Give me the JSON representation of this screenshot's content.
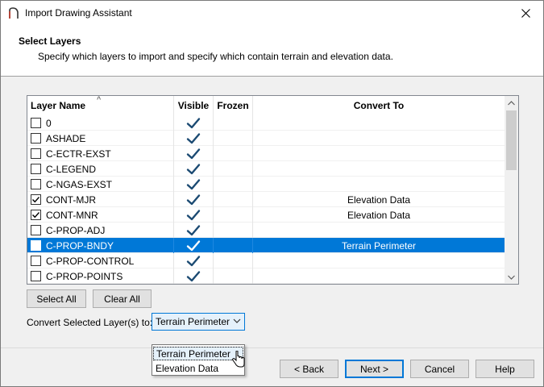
{
  "window": {
    "title": "Import Drawing Assistant",
    "close_glyph": "✕"
  },
  "header": {
    "title": "Select Layers",
    "subtitle": "Specify which layers to import and specify which contain terrain and elevation data."
  },
  "grid": {
    "columns": [
      "Layer Name",
      "Visible",
      "Frozen",
      "Convert To"
    ],
    "sort_glyph": "^",
    "rows": [
      {
        "name": "0",
        "checked": false,
        "visible": true,
        "frozen": false,
        "convert": "",
        "selected": false
      },
      {
        "name": "ASHADE",
        "checked": false,
        "visible": true,
        "frozen": false,
        "convert": "",
        "selected": false
      },
      {
        "name": "C-ECTR-EXST",
        "checked": false,
        "visible": true,
        "frozen": false,
        "convert": "",
        "selected": false
      },
      {
        "name": "C-LEGEND",
        "checked": false,
        "visible": true,
        "frozen": false,
        "convert": "",
        "selected": false
      },
      {
        "name": "C-NGAS-EXST",
        "checked": false,
        "visible": true,
        "frozen": false,
        "convert": "",
        "selected": false
      },
      {
        "name": "CONT-MJR",
        "checked": true,
        "visible": true,
        "frozen": false,
        "convert": "Elevation Data",
        "selected": false
      },
      {
        "name": "CONT-MNR",
        "checked": true,
        "visible": true,
        "frozen": false,
        "convert": "Elevation Data",
        "selected": false
      },
      {
        "name": "C-PROP-ADJ",
        "checked": false,
        "visible": true,
        "frozen": false,
        "convert": "",
        "selected": false
      },
      {
        "name": "C-PROP-BNDY",
        "checked": true,
        "visible": true,
        "frozen": false,
        "convert": "Terrain Perimeter",
        "selected": true
      },
      {
        "name": "C-PROP-CONTROL",
        "checked": false,
        "visible": true,
        "frozen": false,
        "convert": "",
        "selected": false
      },
      {
        "name": "C-PROP-POINTS",
        "checked": false,
        "visible": true,
        "frozen": false,
        "convert": "",
        "selected": false
      }
    ]
  },
  "buttons": {
    "select_all": "Select All",
    "clear_all": "Clear All",
    "back": "< Back",
    "next": "Next >",
    "cancel": "Cancel",
    "help": "Help"
  },
  "convert": {
    "label": "Convert Selected Layer(s) to:",
    "selected": "Terrain Perimeter",
    "options": [
      "Terrain Perimeter",
      "Elevation Data"
    ],
    "highlighted_index": 0
  },
  "colors": {
    "accent": "#0078d7",
    "check": "#1b4a72"
  }
}
